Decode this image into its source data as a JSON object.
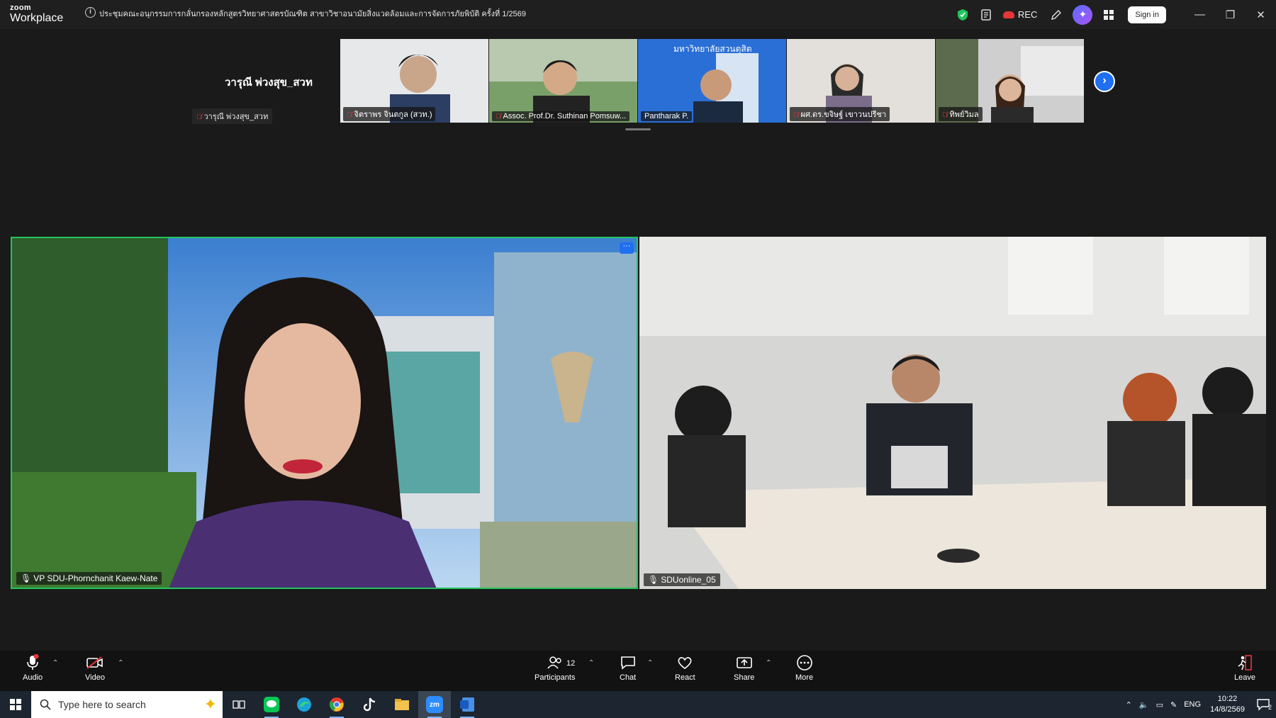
{
  "titlebar": {
    "logo_small": "zoom",
    "logo_big": "Workplace",
    "meeting_title": "ประชุมคณะอนุกรรมการกลั่นกรองหลักสูตรวิทยาศาสตรบัณฑิต สาขาวิชาอนามัยสิ่งแวดล้อมและการจัดการภัยพิบัติ ครั้งที่ 1/2569",
    "rec_label": "REC",
    "signin_label": "Sign in"
  },
  "strip": {
    "self_display_name": "วารุณี พ่วงสุข_สวท",
    "self_label": "วารุณี พ่วงสุข_สวท",
    "participants": [
      {
        "name": "จิตราพร จินตกูล (สวท.)"
      },
      {
        "name": "Assoc. Prof.Dr. Suthinan Pomsuw..."
      },
      {
        "name": "Pantharak P."
      },
      {
        "name": "ผศ.ดร.ขจิษฐ์ เขาวนปรีชา"
      },
      {
        "name": "ทิพย์วิมล"
      }
    ],
    "banner_text": "มหาวิทยาลัยสวนดุสิต"
  },
  "tiles": {
    "left_name": "VP SDU-Phornchanit Kaew-Nate",
    "left_more": "···",
    "right_name": "SDUonline_05"
  },
  "toolbar": {
    "audio": "Audio",
    "video": "Video",
    "participants": "Participants",
    "participant_count": "12",
    "chat": "Chat",
    "react": "React",
    "share": "Share",
    "more": "More",
    "leave": "Leave"
  },
  "taskbar": {
    "search_placeholder": "Type here to search",
    "language": "ENG",
    "time": "10:22",
    "date": "14/8/2569",
    "notification_count": "2"
  },
  "colors": {
    "active_speaker_border": "#22c55e",
    "accent_blue": "#1f6ff0",
    "leave_red": "#e8353a"
  }
}
